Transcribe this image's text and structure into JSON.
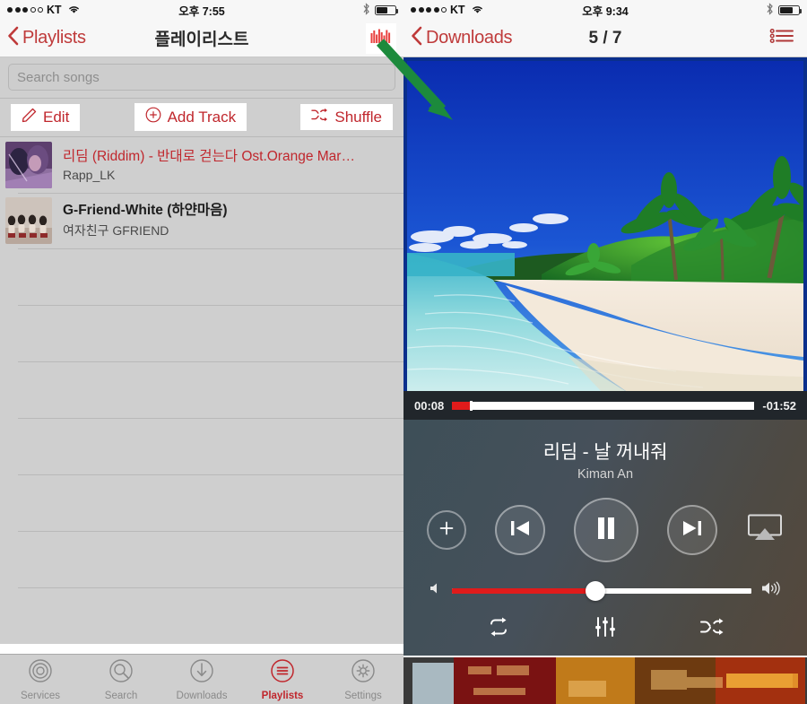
{
  "left_phone": {
    "status_bar": {
      "signal_dots_filled": 3,
      "signal_dots_total": 5,
      "carrier": "KT",
      "wifi_icon": "wifi-icon",
      "time": "오후 7:55",
      "bluetooth_icon": "bluetooth-icon",
      "battery_level_percent": 55
    },
    "nav_bar": {
      "back_label": "Playlists",
      "back_icon": "chevron-left-icon",
      "title": "플레이리스트",
      "eq_icon": "equalizer-icon"
    },
    "search": {
      "placeholder": "Search songs"
    },
    "actions": [
      {
        "label": "Edit",
        "icon": "pencil-icon"
      },
      {
        "label": "Add Track",
        "icon": "plus-circle-icon"
      },
      {
        "label": "Shuffle",
        "icon": "shuffle-icon"
      }
    ],
    "tracks": [
      {
        "title": "리딤 (Riddim) - 반대로 걷는다 Ost.Orange Mar…",
        "artist": "Rapp_LK",
        "state": "playing"
      },
      {
        "title": "G-Friend-White (하얀마음)",
        "artist": "여자친구 GFRIEND",
        "state": "normal"
      }
    ],
    "empty_rows": 7,
    "tab_bar": [
      {
        "label": "Services",
        "icon": "services-icon",
        "active": false
      },
      {
        "label": "Search",
        "icon": "search-icon",
        "active": false
      },
      {
        "label": "Downloads",
        "icon": "download-icon",
        "active": false
      },
      {
        "label": "Playlists",
        "icon": "playlist-icon",
        "active": true
      },
      {
        "label": "Settings",
        "icon": "gear-icon",
        "active": false
      }
    ]
  },
  "right_phone": {
    "status_bar": {
      "signal_dots_filled": 4,
      "signal_dots_total": 5,
      "carrier": "KT",
      "wifi_icon": "wifi-icon",
      "time": "오후 9:34",
      "bluetooth_icon": "bluetooth-icon",
      "battery_level_percent": 62
    },
    "nav_bar": {
      "back_label": "Downloads",
      "back_icon": "chevron-left-icon",
      "title": "5 / 7",
      "list_icon": "bulleted-list-icon"
    },
    "artwork": {
      "description": "tropical-beach-photo"
    },
    "progress": {
      "elapsed": "00:08",
      "remaining": "-01:52",
      "played_percent": 6
    },
    "now_playing": {
      "title": "리딤 - 날 꺼내줘",
      "artist": "Kiman An"
    },
    "transport": [
      {
        "name": "add-button",
        "icon": "plus-icon"
      },
      {
        "name": "previous-button",
        "icon": "previous-track-icon"
      },
      {
        "name": "play-pause-button",
        "icon": "pause-icon"
      },
      {
        "name": "next-button",
        "icon": "next-track-icon"
      },
      {
        "name": "airplay-button",
        "icon": "airplay-icon"
      }
    ],
    "volume": {
      "min_icon": "volume-low-icon",
      "max_icon": "volume-high-icon",
      "level_percent": 48
    },
    "modes": [
      {
        "label": "repeat",
        "icon": "repeat-icon"
      },
      {
        "label": "equalizer",
        "icon": "equalizer-sliders-icon"
      },
      {
        "label": "shuffle",
        "icon": "shuffle-icon"
      }
    ],
    "ad_banner": {
      "description": "blurred-ad-banner"
    }
  },
  "annotation": {
    "arrow_icon": "green-arrow-icon",
    "color": "#1c8a3c"
  },
  "colors": {
    "accent_red": "#c0272d",
    "panel_gray": "#cfcfcf",
    "status_bg": "#f7f7f7",
    "player_dark": "#21262b",
    "progress_red": "#e01b1b"
  }
}
